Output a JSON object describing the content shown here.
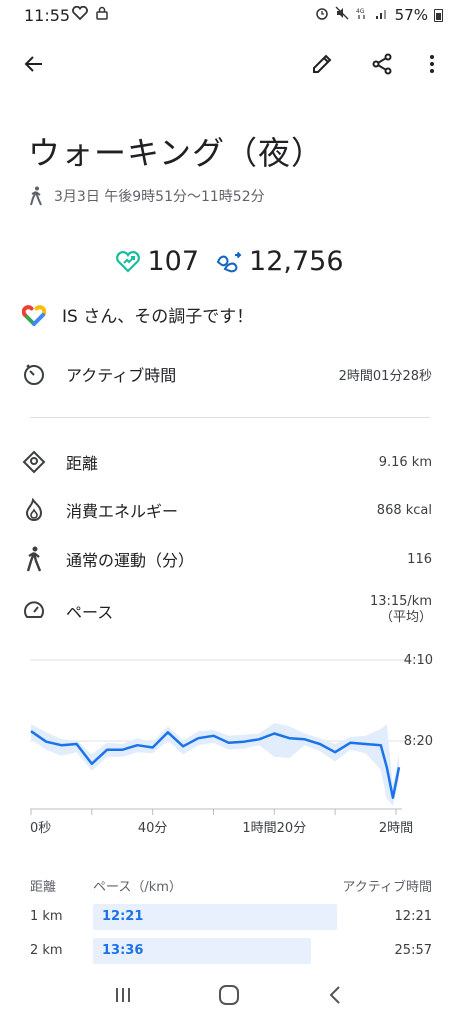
{
  "status_bar": {
    "time": "11:55",
    "battery": "57%"
  },
  "activity": {
    "title": "ウォーキング（夜）",
    "datetime": "3月3日 午後9時51分〜11時52分"
  },
  "metrics": {
    "heart_points": "107",
    "steps": "12,756"
  },
  "encouragement": "IS さん、その調子です！",
  "active_time": {
    "label": "アクティブ時間",
    "value": "2時間01分28秒"
  },
  "stats": [
    {
      "label": "距離",
      "value": "9.16 km"
    },
    {
      "label": "消費エネルギー",
      "value": "868 kcal"
    },
    {
      "label": "通常の運動（分）",
      "value": "116"
    },
    {
      "label": "ペース",
      "value": "13:15/km",
      "sub": "（平均）"
    }
  ],
  "chart_data": {
    "type": "line",
    "x_tick_labels": [
      "0秒",
      "40分",
      "1時間20分",
      "2時間"
    ],
    "y_tick_labels": [
      "4:10",
      "8:20"
    ],
    "x": [
      0,
      5,
      10,
      15,
      20,
      25,
      30,
      35,
      40,
      45,
      50,
      55,
      60,
      65,
      70,
      75,
      80,
      85,
      90,
      95,
      100,
      105,
      110,
      115,
      117,
      119,
      121
    ],
    "series": [
      {
        "values": [
          10.2,
          11.1,
          11.4,
          11.3,
          13.0,
          11.8,
          11.8,
          11.4,
          11.6,
          10.3,
          11.5,
          10.8,
          10.6,
          11.2,
          11.1,
          10.9,
          10.4,
          10.8,
          10.9,
          11.3,
          12.0,
          11.2,
          11.3,
          11.4,
          13.3,
          15.9,
          13.3
        ]
      }
    ],
    "band": {
      "lower": [
        9.6,
        10.3,
        10.9,
        11.0,
        12.2,
        11.2,
        11.3,
        10.8,
        11.1,
        9.8,
        11.0,
        10.2,
        10.1,
        10.6,
        10.5,
        10.4,
        9.5,
        9.8,
        10.4,
        10.8,
        11.3,
        10.7,
        10.6,
        10.0,
        9.6,
        14.8,
        12.2
      ],
      "upper": [
        10.9,
        11.8,
        12.3,
        12.0,
        13.6,
        12.4,
        12.4,
        12.0,
        12.1,
        11.0,
        12.2,
        11.4,
        11.2,
        11.8,
        11.7,
        11.4,
        12.4,
        12.5,
        11.4,
        11.9,
        12.8,
        11.8,
        12.1,
        13.5,
        16.0,
        16.6,
        14.4
      ]
    },
    "xlim": [
      0,
      121
    ],
    "ylim": [
      4.1,
      16.7
    ],
    "y_axis_inverted": true,
    "grid": true
  },
  "splits": {
    "headers": {
      "distance": "距離",
      "pace": "ペース（/km）",
      "active_time": "アクティブ時間"
    },
    "rows": [
      {
        "distance": "1 km",
        "pace": "12:21",
        "pace_fraction": 0.74,
        "active": "12:21"
      },
      {
        "distance": "2 km",
        "pace": "13:36",
        "pace_fraction": 0.66,
        "active": "25:57"
      }
    ]
  },
  "colors": {
    "accent": "#1a73e8",
    "heart": "#1abc9c",
    "steps": "#1565c0",
    "band": "#e1ecfc"
  }
}
